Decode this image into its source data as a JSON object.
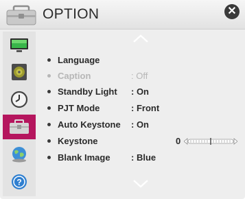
{
  "header": {
    "title": "OPTION",
    "close_icon": "close-icon"
  },
  "sidebar": {
    "items": [
      {
        "icon": "picture-icon"
      },
      {
        "icon": "audio-icon"
      },
      {
        "icon": "time-icon"
      },
      {
        "icon": "option-icon",
        "selected": true
      },
      {
        "icon": "network-icon"
      },
      {
        "icon": "support-icon"
      }
    ]
  },
  "menu": {
    "scroll_up_icon": "chevron-up-icon",
    "scroll_down_icon": "chevron-down-icon",
    "items": [
      {
        "label": "Language",
        "value": ""
      },
      {
        "label": "Caption",
        "value": ": Off",
        "disabled": true
      },
      {
        "label": "Standby Light",
        "value": ": On"
      },
      {
        "label": "PJT Mode",
        "value": ": Front"
      },
      {
        "label": "Auto Keystone",
        "value": ": On"
      },
      {
        "label": "Keystone",
        "value": "0",
        "slider_position": 0.5
      },
      {
        "label": "Blank Image",
        "value": ": Blue"
      }
    ]
  },
  "colors": {
    "accent": "#b5165e",
    "background": "#eeeeee",
    "text": "#2a2a2a",
    "disabled_text": "#b6b6b6"
  }
}
